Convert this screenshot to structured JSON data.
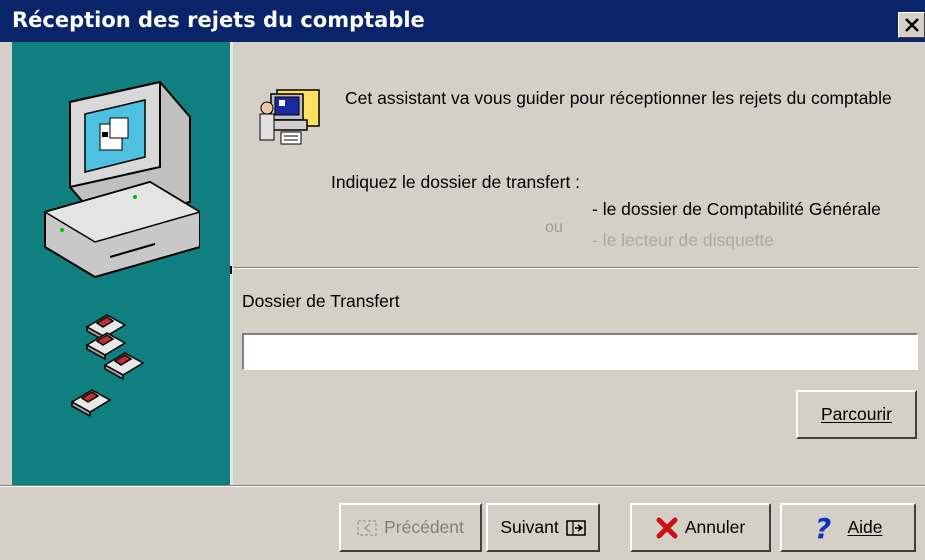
{
  "window": {
    "title": "Réception des rejets du comptable"
  },
  "intro": "Cet assistant va vous guider pour réceptionner les rejets du comptable",
  "instruction": "Indiquez le dossier de transfert :",
  "or_text": "ou",
  "options": [
    "- le dossier de Comptabilité Générale",
    "- le  lecteur de disquette"
  ],
  "field": {
    "label": "Dossier de Transfert",
    "value": ""
  },
  "buttons": {
    "browse": "Parcourir",
    "previous": "Précédent",
    "next": "Suivant",
    "cancel": "Annuler",
    "help": "Aide"
  },
  "icons": {
    "close": "close-icon",
    "computer": "computer-icon",
    "diskettes": "diskette-icon",
    "wizard": "wizard-icon",
    "previous": "previous-arrow-icon",
    "next": "next-arrow-icon",
    "cancel": "red-x-icon",
    "help": "question-icon"
  },
  "colors": {
    "titlebar": "#0a246a",
    "panel": "#0f7f7f",
    "face": "#d4d0c8"
  }
}
